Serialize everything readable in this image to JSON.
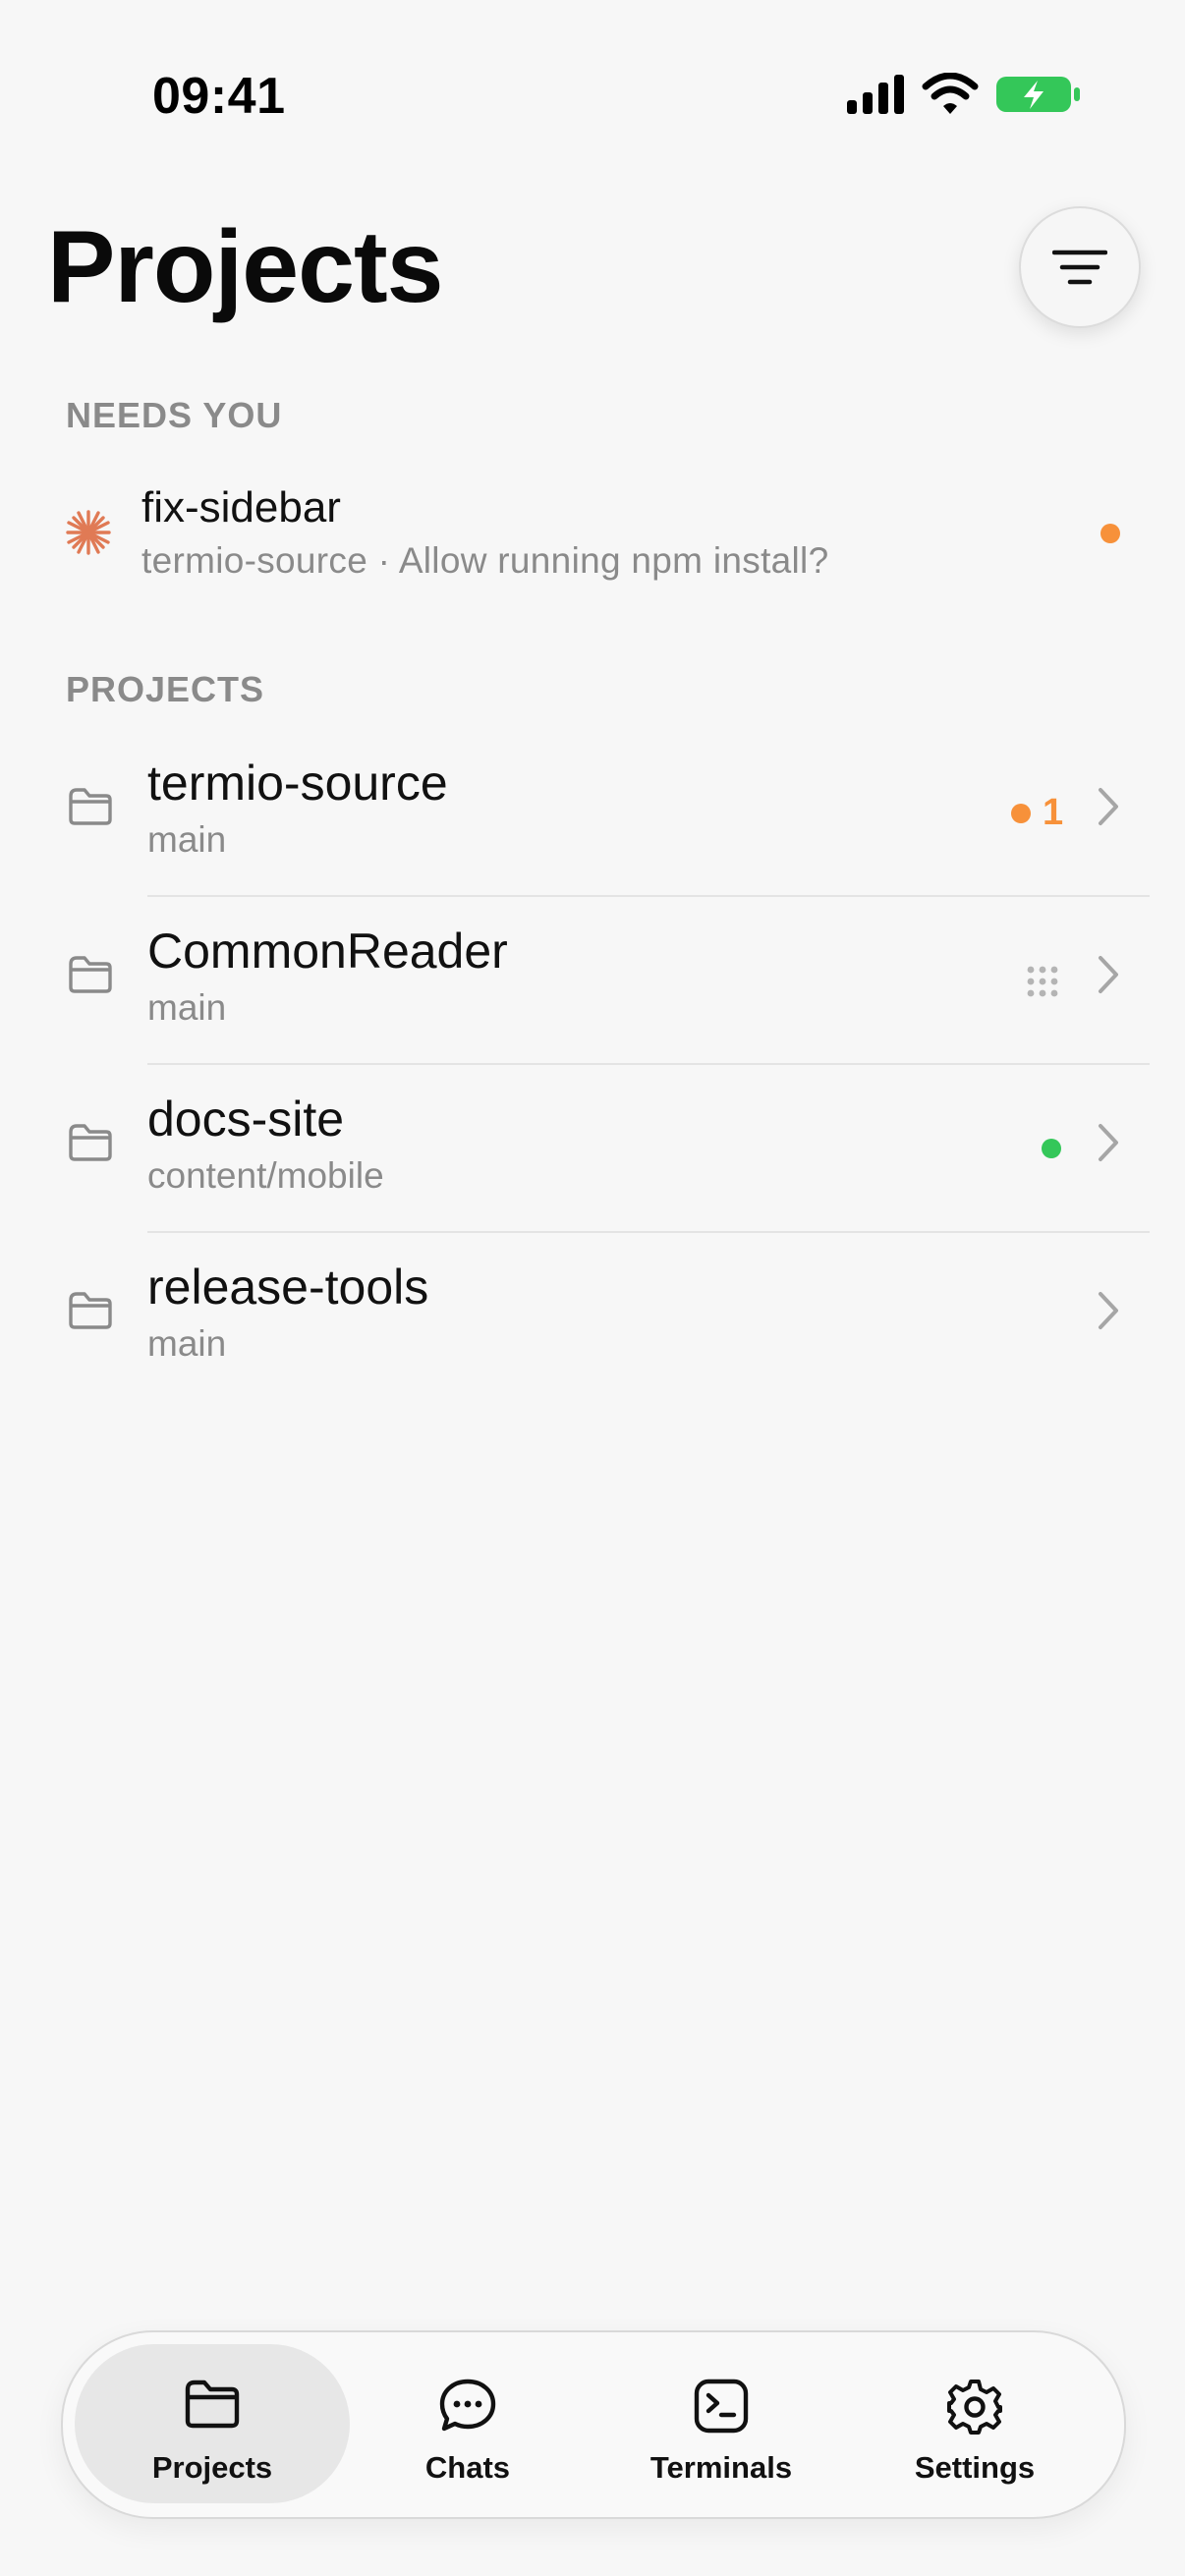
{
  "status_bar": {
    "time": "09:41"
  },
  "header": {
    "title": "Projects"
  },
  "needs_you": {
    "header": "NEEDS YOU",
    "items": [
      {
        "title": "fix-sidebar",
        "subtitle": "termio-source · Allow running npm install?",
        "status_color": "#f7913a"
      }
    ]
  },
  "projects": {
    "header": "PROJECTS",
    "items": [
      {
        "name": "termio-source",
        "branch": "main",
        "badge_count": "1",
        "status": "pending"
      },
      {
        "name": "CommonReader",
        "branch": "main",
        "status": "idle-grid"
      },
      {
        "name": "docs-site",
        "branch": "content/mobile",
        "status": "active"
      },
      {
        "name": "release-tools",
        "branch": "main",
        "status": "none"
      }
    ]
  },
  "tab_bar": {
    "tabs": [
      {
        "label": "Projects",
        "icon": "folder-icon",
        "active": true
      },
      {
        "label": "Chats",
        "icon": "chat-bubble-icon",
        "active": false
      },
      {
        "label": "Terminals",
        "icon": "terminal-icon",
        "active": false
      },
      {
        "label": "Settings",
        "icon": "gear-icon",
        "active": false
      }
    ]
  },
  "colors": {
    "accent_orange": "#f7913a",
    "active_green": "#34c759",
    "spark": "#e07a55",
    "battery_green": "#34c759"
  }
}
